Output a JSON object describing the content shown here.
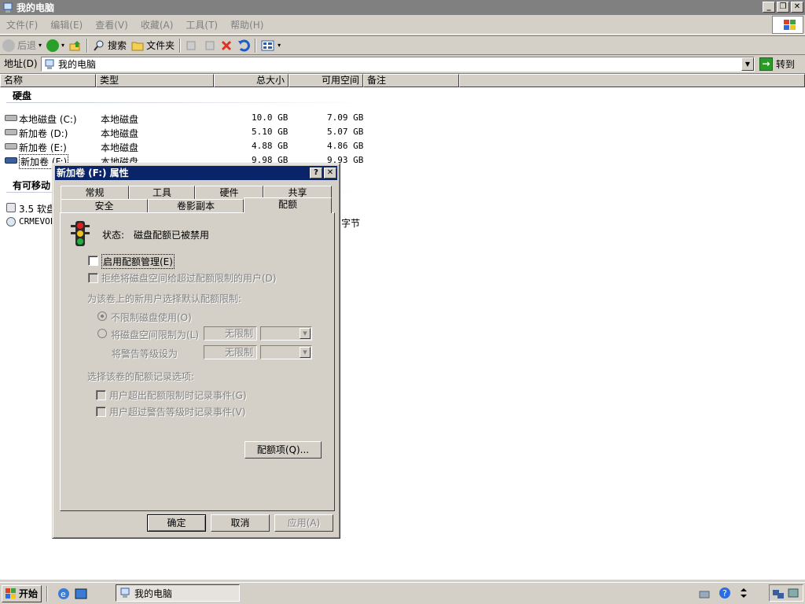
{
  "window": {
    "title": "我的电脑"
  },
  "menu": [
    "文件(F)",
    "编辑(E)",
    "查看(V)",
    "收藏(A)",
    "工具(T)",
    "帮助(H)"
  ],
  "toolbar": {
    "back": "后退",
    "search": "搜索",
    "folders": "文件夹"
  },
  "address": {
    "label": "地址(D)",
    "value": "我的电脑",
    "go": "转到"
  },
  "columns": [
    "名称",
    "类型",
    "总大小",
    "可用空间",
    "备注"
  ],
  "groups": {
    "hard_disks": "硬盘",
    "removable": "有可移动"
  },
  "drives": [
    {
      "name": "本地磁盘 (C:)",
      "type": "本地磁盘",
      "total": "10.0 GB",
      "free": "7.09 GB"
    },
    {
      "name": "新加卷 (D:)",
      "type": "本地磁盘",
      "total": "5.10 GB",
      "free": "5.07 GB"
    },
    {
      "name": "新加卷 (E:)",
      "type": "本地磁盘",
      "total": "4.88 GB",
      "free": "4.86 GB"
    },
    {
      "name": "新加卷 (F:)",
      "type": "本地磁盘",
      "total": "9.98 GB",
      "free": "9.93 GB"
    }
  ],
  "removables": [
    {
      "name": "3.5 软盘"
    },
    {
      "name": "CRMEVOL",
      "size_suffix": "字节"
    }
  ],
  "dialog": {
    "title": "新加卷 (F:) 属性",
    "tabs_row1": [
      "常规",
      "工具",
      "硬件",
      "共享"
    ],
    "tabs_row2": [
      "安全",
      "卷影副本",
      "配额"
    ],
    "status_label": "状态:",
    "status_value": "磁盘配额已被禁用",
    "enable_quota": "启用配额管理(E)",
    "deny_space": "拒绝将磁盘空间给超过配额限制的用户(D)",
    "default_limit_header": "为该卷上的新用户选择默认配额限制:",
    "no_limit": "不限制磁盘使用(O)",
    "limit_to": "将磁盘空间限制为(L)",
    "warn_level": "将警告等级设为",
    "limit_value": "无限制",
    "warn_value": "无限制",
    "log_header": "选择该卷的配额记录选项:",
    "log_exceed": "用户超出配额限制时记录事件(G)",
    "log_warn": "用户超过警告等级时记录事件(V)",
    "entries_btn": "配额项(Q)...",
    "ok": "确定",
    "cancel": "取消",
    "apply": "应用(A)"
  },
  "taskbar": {
    "start": "开始",
    "task": "我的电脑"
  }
}
